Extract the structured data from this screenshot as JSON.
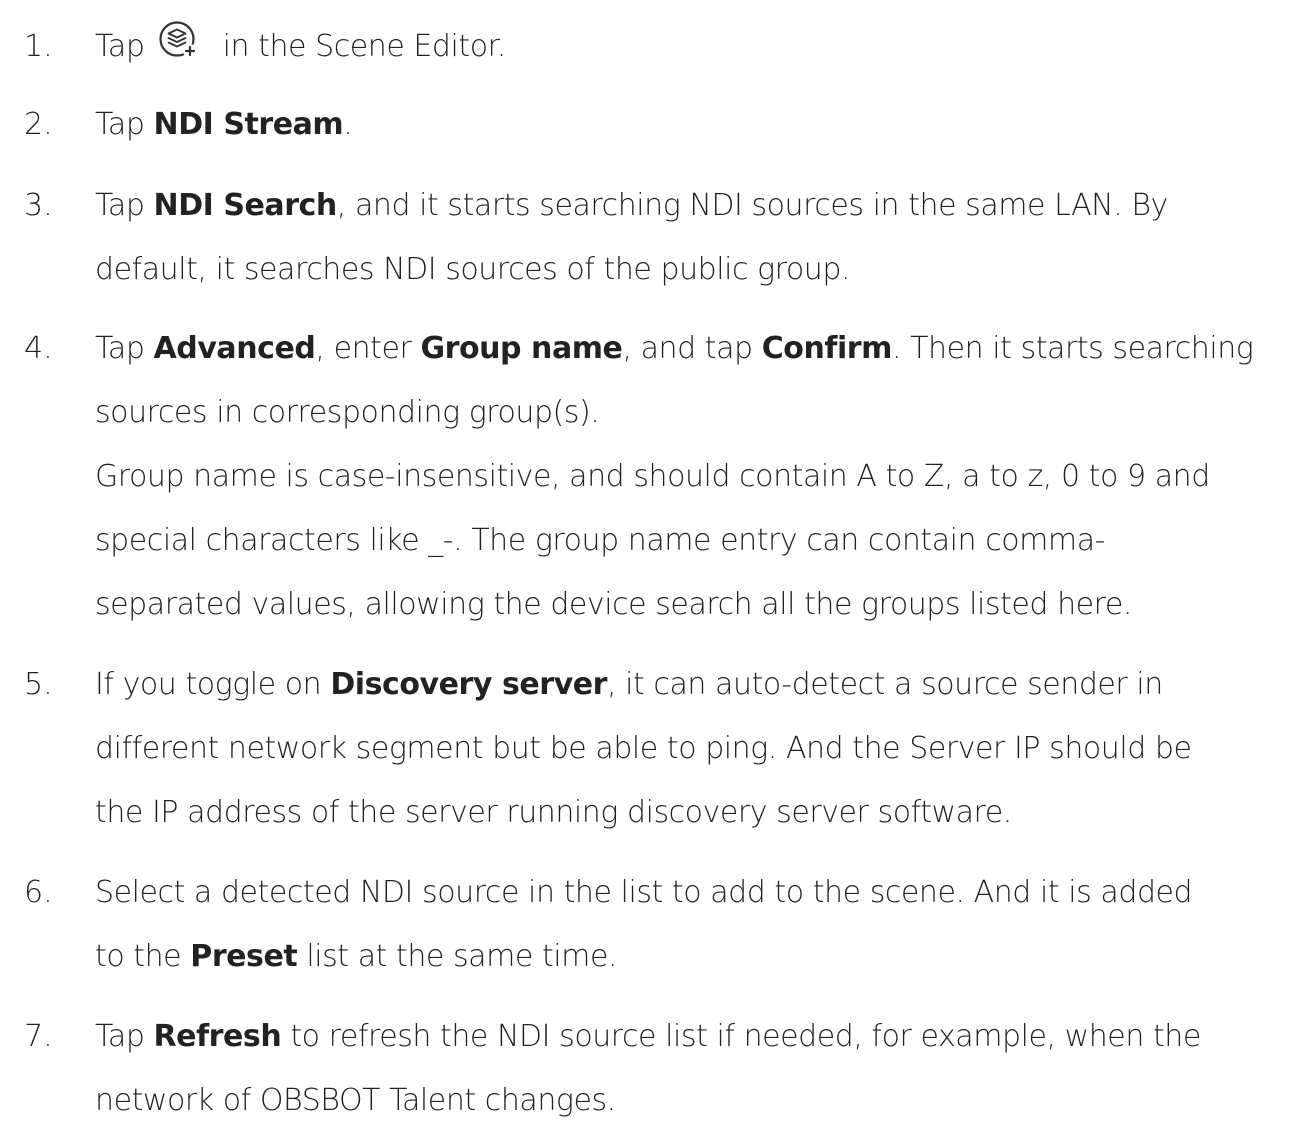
{
  "steps": [
    {
      "number": "1.",
      "parts": {
        "a": "Tap ",
        "icon": "add-source-layers-icon",
        "b": " in the Scene Editor."
      }
    },
    {
      "number": "2.",
      "parts": {
        "a": "Tap ",
        "bold1": "NDI Stream",
        "b": "."
      }
    },
    {
      "number": "3.",
      "lines": {
        "l1a": "Tap ",
        "l1bold": "NDI Search",
        "l1b": ", and it starts searching NDI sources in the same LAN. By",
        "l2": "default, it searches NDI sources of the public group."
      }
    },
    {
      "number": "4.",
      "lines": {
        "l1a": "Tap ",
        "l1bold1": "Advanced",
        "l1b": ", enter ",
        "l1bold2": "Group name",
        "l1c": ", and tap ",
        "l1bold3": "Confirm",
        "l1d": ". Then it starts searching",
        "l2": "sources in corresponding group(s).",
        "l3": "Group name is case-insensitive, and should contain A to Z, a to z, 0 to 9 and",
        "l4": "special characters like _-. The group name entry can contain comma-",
        "l5": "separated values, allowing the device search all the groups listed here."
      }
    },
    {
      "number": "5.",
      "lines": {
        "l1a": "If you toggle on ",
        "l1bold": "Discovery server",
        "l1b": ", it can auto-detect a source sender in",
        "l2": "different network segment but be able to ping. And the Server IP should be",
        "l3": "the IP address of the server running discovery server software."
      }
    },
    {
      "number": "6.",
      "lines": {
        "l1": "Select a detected NDI source in the list to add to the scene. And it is added",
        "l2a": "to the ",
        "l2bold": "Preset",
        "l2b": " list at the same time."
      }
    },
    {
      "number": "7.",
      "lines": {
        "l1a": "Tap ",
        "l1bold": "Refresh",
        "l1b": " to refresh the NDI source list if needed, for example, when the",
        "l2": "network of OBSBOT Talent changes."
      }
    }
  ]
}
